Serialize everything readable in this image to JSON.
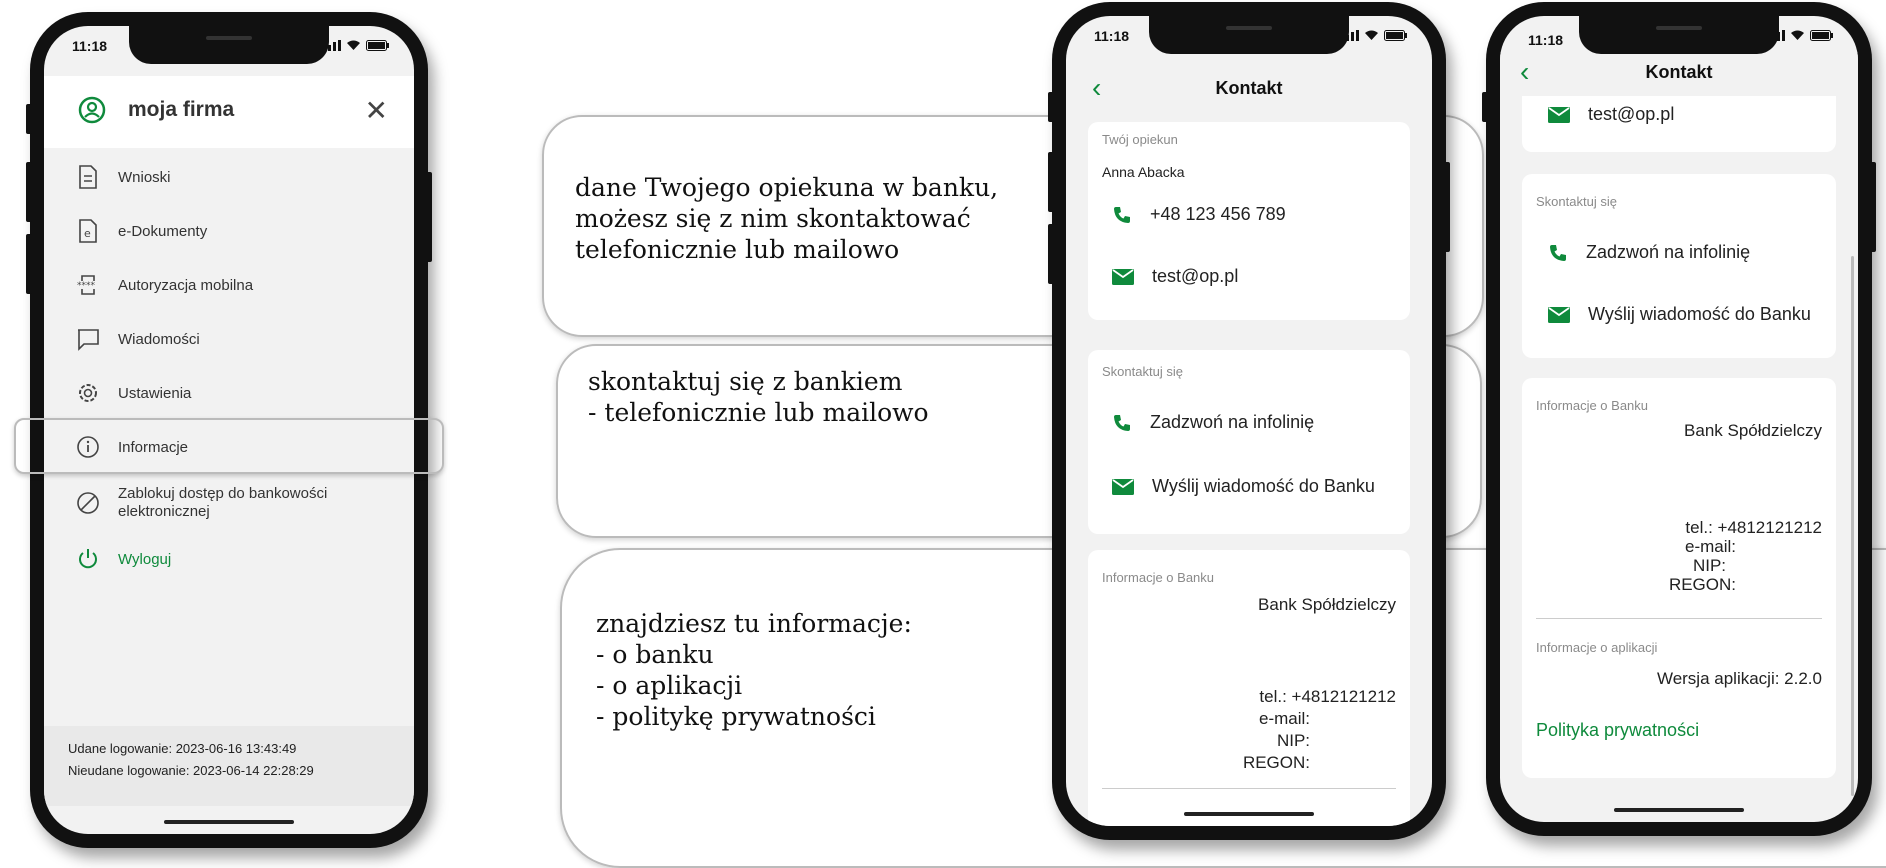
{
  "status": {
    "time": "11:18"
  },
  "menu": {
    "title": "moja firma",
    "items": [
      {
        "label": "Wnioski",
        "icon": "document-icon"
      },
      {
        "label": "e-Dokumenty",
        "icon": "e-document-icon"
      },
      {
        "label": "Autoryzacja mobilna",
        "icon": "mobile-auth-icon"
      },
      {
        "label": "Wiadomości",
        "icon": "message-icon"
      },
      {
        "label": "Ustawienia",
        "icon": "gear-icon"
      },
      {
        "label": "Informacje",
        "icon": "info-icon"
      },
      {
        "label": "Zablokuj dostęp do bankowości\nelektronicznej",
        "icon": "block-icon"
      },
      {
        "label": "Wyloguj",
        "icon": "power-icon"
      }
    ],
    "footer": {
      "success": "Udane logowanie: 2023-06-16 13:43:49",
      "failed": "Nieudane logowanie: 2023-06-14 22:28:29"
    }
  },
  "contact": {
    "title": "Kontakt",
    "advisor_label": "Twój opiekun",
    "advisor_name": "Anna Abacka",
    "phone": "+48 123 456 789",
    "email": "test@op.pl",
    "contact_label": "Skontaktuj się",
    "call": "Zadzwoń na infolinię",
    "message": "Wyślij wiadomość do Banku",
    "bank_label": "Informacje o Banku",
    "bank_name": "Bank Spółdzielczy",
    "bank_tel": "tel.: +4812121212",
    "bank_email": "e-mail:",
    "bank_nip": "NIP:",
    "bank_regon": "REGON:",
    "app_label": "Informacje o aplikacji",
    "app_version": "Wersja aplikacji: 2.2.0",
    "privacy": "Polityka prywatności"
  },
  "callouts": {
    "advisor": "dane Twojego opiekuna w banku,\nmożesz się z nim skontaktować\ntelefonicznie lub mailowo",
    "contact": "skontaktuj się z bankiem\n- telefonicznie lub mailowo",
    "info": "znajdziesz tu informacje:\n- o banku\n- o aplikacji\n- politykę prywatności"
  },
  "colors": {
    "accent": "#0f8a3c",
    "background": "#f2f2f2"
  }
}
